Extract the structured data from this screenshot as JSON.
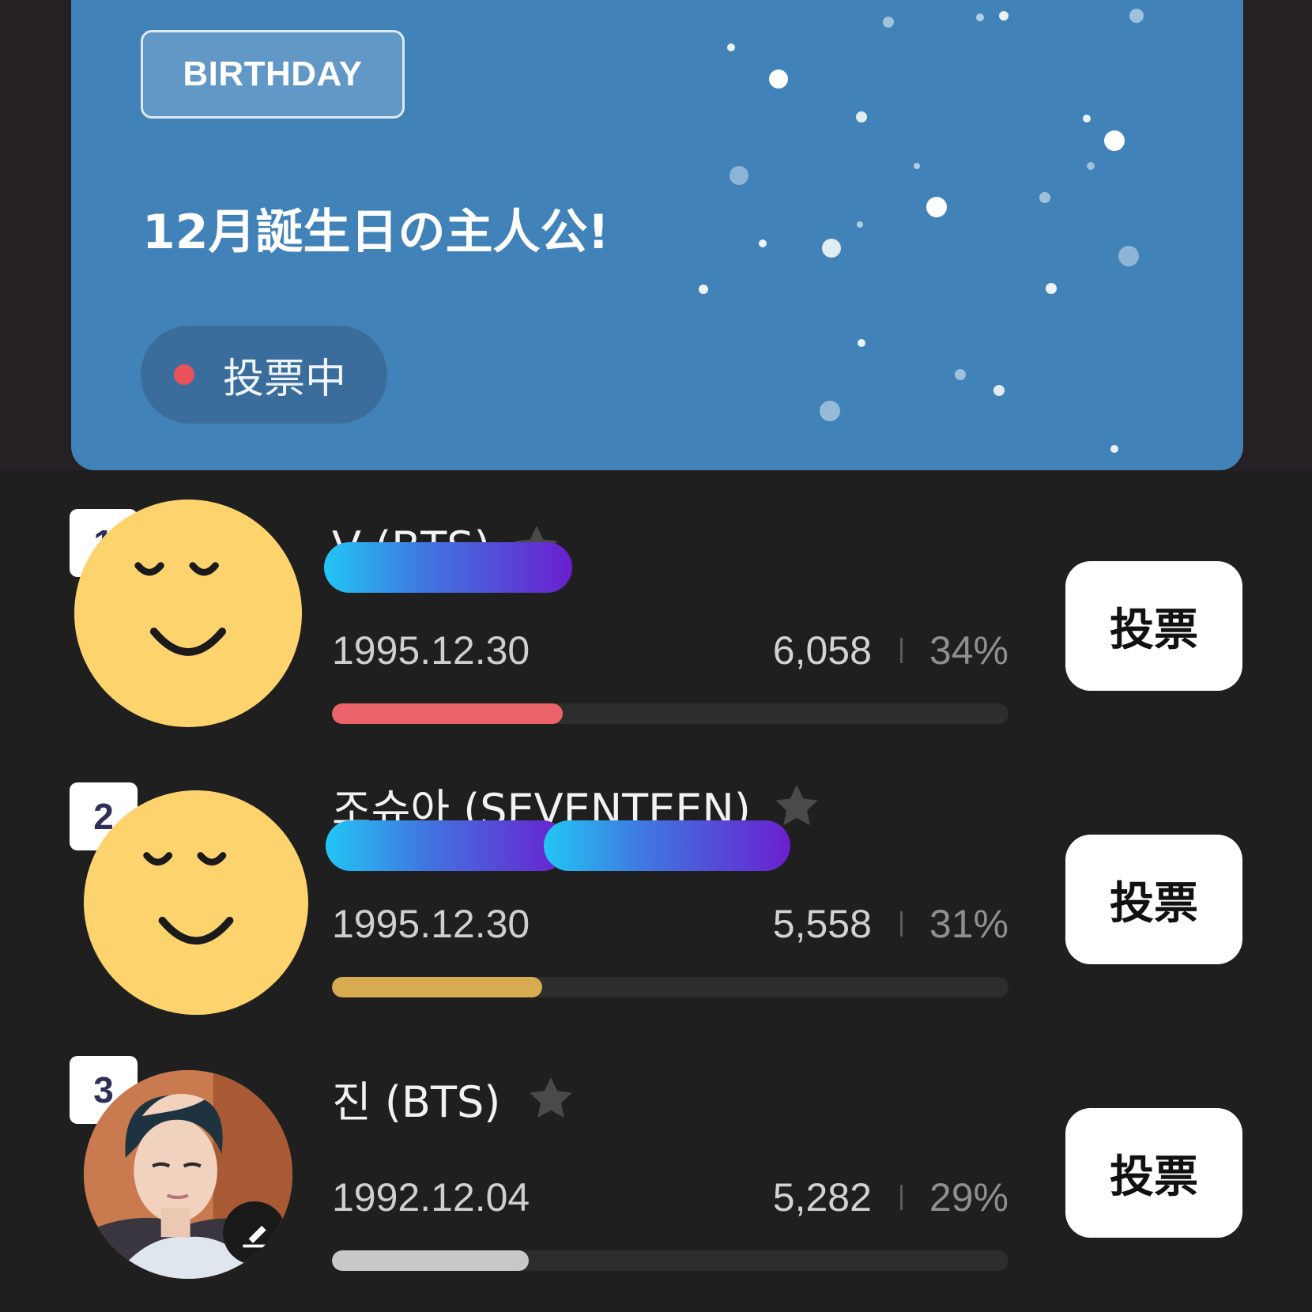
{
  "banner": {
    "badge": "BIRTHDAY",
    "title": "12月誕生日の主人公!",
    "status": "投票中",
    "background_color": "#4182b9",
    "status_dot_color": "#e8525a"
  },
  "ranking": [
    {
      "rank": "1",
      "name": "V (BTS)",
      "name_redacted": true,
      "birthdate": "1995.12.30",
      "votes": "6,058",
      "percent": "34%",
      "share": 0.34,
      "bar_color": "#e96368",
      "vote_label": "投票",
      "avatar_icon": "smiley-face-icon"
    },
    {
      "rank": "2",
      "name": "조슈아 (SEVENTEEN)",
      "name_redacted": true,
      "birthdate": "1995.12.30",
      "votes": "5,558",
      "percent": "31%",
      "share": 0.31,
      "bar_color": "#d9ab50",
      "vote_label": "投票",
      "avatar_icon": "smiley-face-icon"
    },
    {
      "rank": "3",
      "name": "진 (BTS)",
      "name_redacted": false,
      "birthdate": "1992.12.04",
      "votes": "5,282",
      "percent": "29%",
      "share": 0.29,
      "bar_color": "#c8c8c8",
      "vote_label": "投票",
      "avatar_icon": "profile-photo",
      "avatar_badge_icon": "edit-download-icon"
    }
  ]
}
